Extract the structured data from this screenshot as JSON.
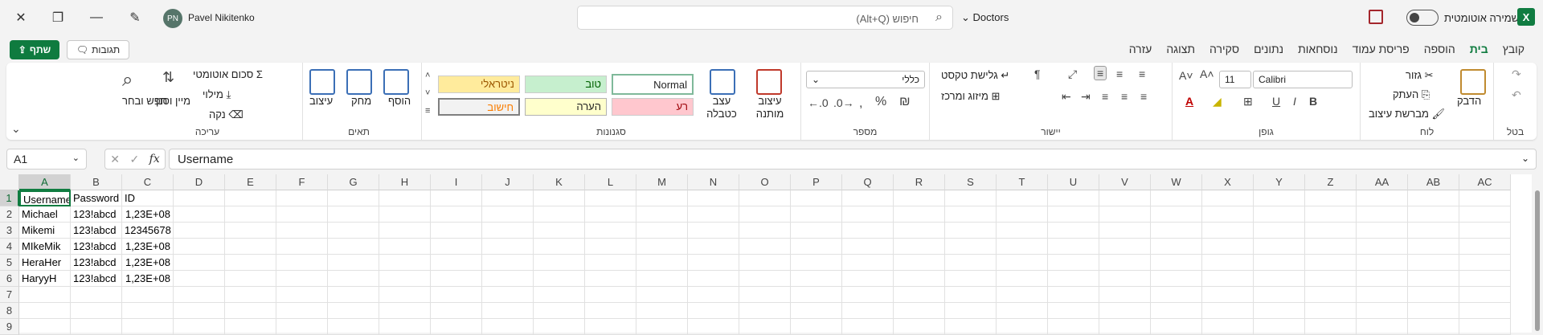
{
  "titlebar": {
    "user_initials": "PN",
    "user_name": "Pavel Nikitenko",
    "search_placeholder": "חיפוש (Alt+Q)",
    "document_name": "Doctors",
    "autosave_label": "שמירה אוטומטית",
    "app_logo": "X"
  },
  "tabbar": {
    "share_label": "שתף",
    "comments_label": "תגובות",
    "tabs": [
      "קובץ",
      "בית",
      "הוספה",
      "פריסת עמוד",
      "נוסחאות",
      "נתונים",
      "סקירה",
      "תצוגה",
      "עזרה"
    ]
  },
  "ribbon": {
    "undo": {
      "label": "בטל"
    },
    "clipboard": {
      "label": "לוח",
      "paste": "הדבק",
      "cut": "גזור",
      "copy": "העתק",
      "format_painter": "מברשת עיצוב"
    },
    "font": {
      "label": "גופן",
      "font_name": "Calibri",
      "font_size": "11"
    },
    "alignment": {
      "label": "יישור",
      "wrap_text": "גלישת טקסט",
      "merge_center": "מיזוג ומרכז"
    },
    "number": {
      "label": "מספר",
      "format": "כללי"
    },
    "styles": {
      "label": "סגנונות",
      "conditional_formatting": "עיצוב מותנה",
      "format_as_table": "עצב כטבלה",
      "cell_styles": [
        {
          "name": "Normal"
        },
        {
          "name": "טוב"
        },
        {
          "name": "ניטראלי"
        },
        {
          "name": "רע"
        },
        {
          "name": "הערה"
        },
        {
          "name": "חישוב"
        }
      ]
    },
    "cells": {
      "label": "תאים",
      "insert": "הוסף",
      "delete": "מחק",
      "format": "עיצוב"
    },
    "editing": {
      "label": "עריכה",
      "autosum": "סכום אוטומטי",
      "fill": "מילוי",
      "clear": "נקה",
      "sort_filter": "מיין וסנן",
      "find_select": "חפש ובחר"
    }
  },
  "formula_bar": {
    "name_box": "A1",
    "fx_label": "fx",
    "formula": "Username"
  },
  "sheet": {
    "columns": [
      "A",
      "B",
      "C",
      "D",
      "E",
      "F",
      "G",
      "H",
      "I",
      "J",
      "K",
      "L",
      "M",
      "N",
      "O",
      "P",
      "Q",
      "R",
      "S",
      "T",
      "U",
      "V",
      "W",
      "X",
      "Y",
      "Z",
      "AA",
      "AB",
      "AC"
    ],
    "row_numbers": [
      "1",
      "2",
      "3",
      "4",
      "5",
      "6",
      "7",
      "8",
      "9"
    ],
    "rows": [
      [
        "Username",
        "Password",
        "ID"
      ],
      [
        "Michael",
        "123!abcd",
        "1,23E+08"
      ],
      [
        "Mikemi",
        "123!abcd",
        "12345678"
      ],
      [
        "MIkeMik",
        "123!abcd",
        "1,23E+08"
      ],
      [
        "HeraHer",
        "123!abcd",
        "1,23E+08"
      ],
      [
        "HaryyH",
        "123!abcd",
        "1,23E+08"
      ]
    ]
  },
  "colors": {
    "accent": "#107c41",
    "style_good": "#c6efce",
    "style_neutral": "#ffeb9c",
    "style_bad": "#ffc7ce",
    "style_note": "#ffffcc",
    "style_calc": "#f2f2f2"
  }
}
